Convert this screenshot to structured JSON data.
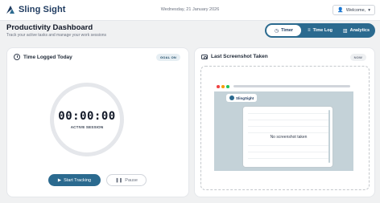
{
  "header": {
    "brand": "Sling Sight",
    "date": "Wednesday, 21 January 2026",
    "user_menu": "Welcome,"
  },
  "page": {
    "title": "Productivity Dashboard",
    "subtitle": "Track your active tasks and manage your work sessions"
  },
  "nav": {
    "tabs": [
      {
        "label": "Timer",
        "icon": "clock-icon",
        "active": true
      },
      {
        "label": "Time Log",
        "icon": "list-icon",
        "active": false
      },
      {
        "label": "Analytics",
        "icon": "chart-icon",
        "active": false
      }
    ]
  },
  "timer_card": {
    "title": "Time Logged Today",
    "badge": "GOAL ON",
    "time": "00:00:00",
    "session_label": "ACTIVE SESSION",
    "start_label": "Start Tracking",
    "pause_label": "Pause"
  },
  "screenshot_card": {
    "title": "Last Screenshot Taken",
    "badge": "NOW",
    "brand": "SlingSight",
    "empty_text": "No screenshot taken"
  },
  "colors": {
    "accent": "#2b6a8f",
    "brand_dark": "#1e3a5f",
    "preview_bg": "#c4d2d8"
  }
}
